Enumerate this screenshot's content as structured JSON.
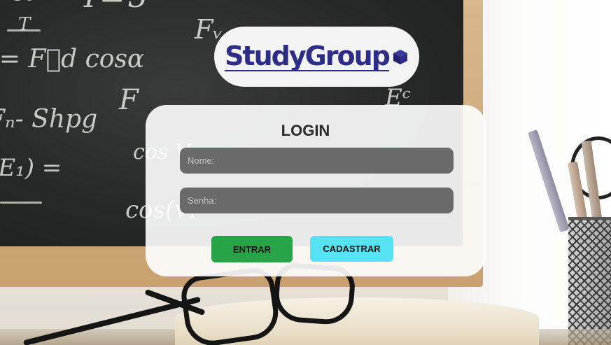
{
  "logo": {
    "text": "StudyGroup",
    "icon": "cube-icon",
    "color": "#2d2c86"
  },
  "login": {
    "title": "LOGIN",
    "name_placeholder": "Nome:",
    "password_placeholder": "Senha:",
    "enter_label": "ENTRAR",
    "register_label": "CADASTRAR"
  },
  "colors": {
    "enter_button": "#27a447",
    "register_button": "#55e3f3",
    "field_background": "#6a6a6a"
  }
}
